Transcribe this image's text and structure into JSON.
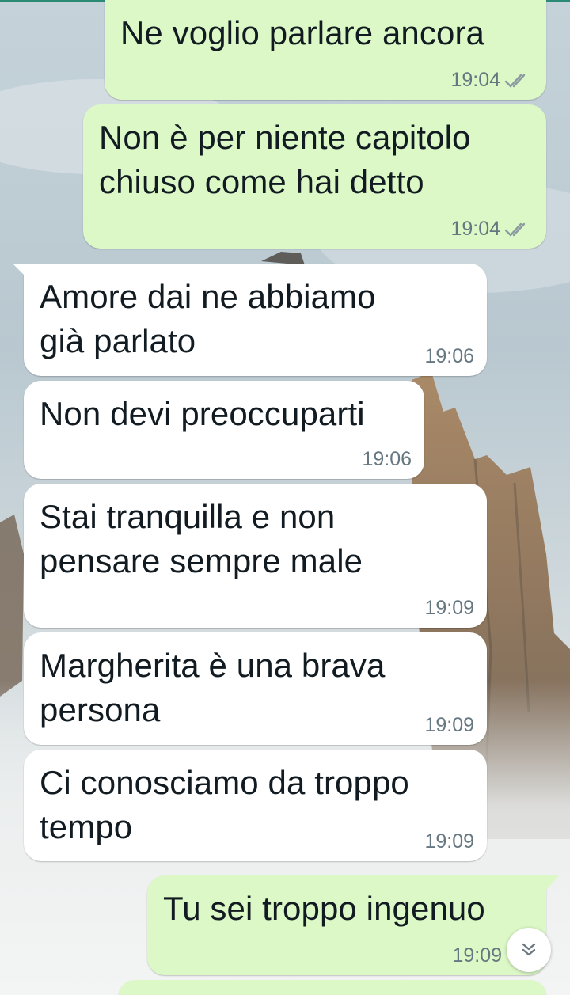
{
  "messages": [
    {
      "direction": "outgoing",
      "text": "Ne voglio parlare ancora",
      "time": "19:04",
      "status": "read"
    },
    {
      "direction": "outgoing",
      "text": "Non è per niente capitolo\nchiuso come hai detto",
      "time": "19:04",
      "status": "read"
    },
    {
      "direction": "incoming",
      "text": "Amore dai ne abbiamo\ngià parlato",
      "time": "19:06"
    },
    {
      "direction": "incoming",
      "text": "Non devi preoccuparti",
      "time": "19:06"
    },
    {
      "direction": "incoming",
      "text": "Stai tranquilla e non\npensare sempre male",
      "time": "19:09"
    },
    {
      "direction": "incoming",
      "text": "Margherita è una brava\npersona",
      "time": "19:09"
    },
    {
      "direction": "incoming",
      "text": "Ci conosciamo da troppo\ntempo",
      "time": "19:09"
    },
    {
      "direction": "outgoing",
      "text": "Tu sei troppo ingenuo",
      "time": "19:09",
      "status": "read"
    }
  ],
  "colors": {
    "outgoing_bubble": "#dcf8c6",
    "incoming_bubble": "#ffffff",
    "timestamp": "#667781",
    "text": "#111b21"
  },
  "icons": {
    "read_receipt": "double-check-icon",
    "scroll_down": "double-chevron-down-icon"
  }
}
